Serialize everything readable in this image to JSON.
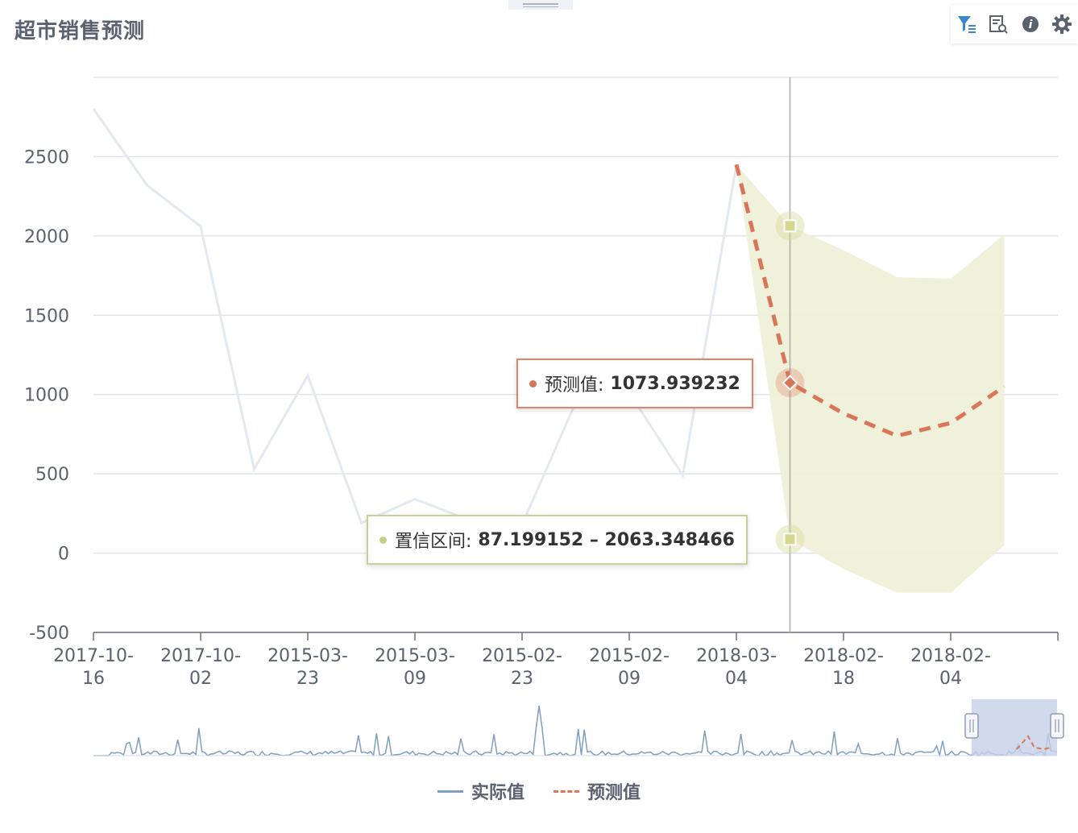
{
  "title": "超市销售预测",
  "toolbox": [
    {
      "name": "filter-icon",
      "color": "#3a87d0"
    },
    {
      "name": "data-view-icon",
      "color": "#5a6270"
    },
    {
      "name": "info-icon",
      "color": "#5a6270"
    },
    {
      "name": "settings-icon",
      "color": "#5a6270"
    }
  ],
  "colors": {
    "actual": "#7e9fbf",
    "forecast": "#d9765a",
    "band": "#eef0d6",
    "band_marker": "#d6dc9e"
  },
  "legend": [
    {
      "label": "实际值",
      "style": "solid"
    },
    {
      "label": "预测值",
      "style": "dashed"
    }
  ],
  "tooltips": {
    "forecast": {
      "label": "预测值:",
      "value": "1073.939232"
    },
    "interval": {
      "label": "置信区间:",
      "value": "87.199152 – 2063.348466"
    }
  },
  "chart_data": {
    "type": "line",
    "title": "超市销售预测",
    "ylim": [
      -500,
      3000
    ],
    "yticks": [
      -500,
      0,
      500,
      1000,
      1500,
      2000,
      2500
    ],
    "x_range": [
      0,
      9
    ],
    "xticks": [
      {
        "x": 0,
        "line1": "2017-10-",
        "line2": "16"
      },
      {
        "x": 1,
        "line1": "2017-10-",
        "line2": "02"
      },
      {
        "x": 2,
        "line1": "2015-03-",
        "line2": "23"
      },
      {
        "x": 3,
        "line1": "2015-03-",
        "line2": "09"
      },
      {
        "x": 4,
        "line1": "2015-02-",
        "line2": "23"
      },
      {
        "x": 5,
        "line1": "2015-02-",
        "line2": "09"
      },
      {
        "x": 6,
        "line1": "2018-03-",
        "line2": "04"
      },
      {
        "x": 7,
        "line1": "2018-02-",
        "line2": "18"
      },
      {
        "x": 8,
        "line1": "2018-02-",
        "line2": "04"
      }
    ],
    "grid": true,
    "legend_position": "bottom-center",
    "series": [
      {
        "name": "实际值",
        "points": [
          [
            0,
            2800
          ],
          [
            0.5,
            2320
          ],
          [
            1,
            2060
          ],
          [
            1.5,
            530
          ],
          [
            2,
            1120
          ],
          [
            2.5,
            190
          ],
          [
            3,
            340
          ],
          [
            3.5,
            210
          ],
          [
            4,
            180
          ],
          [
            4.5,
            950
          ],
          [
            5,
            1010
          ],
          [
            5.5,
            490
          ],
          [
            6,
            2450
          ]
        ]
      },
      {
        "name": "预测值",
        "points": [
          [
            6,
            2450
          ],
          [
            6.5,
            1073.939232
          ],
          [
            7,
            880
          ],
          [
            7.5,
            740
          ],
          [
            8,
            820
          ],
          [
            8.5,
            1050
          ]
        ],
        "interval": [
          [
            6,
            2450,
            2450
          ],
          [
            6.5,
            87.199152,
            2063.348466
          ],
          [
            7,
            -100,
            1910
          ],
          [
            7.5,
            -250,
            1740
          ],
          [
            8,
            -250,
            1730
          ],
          [
            8.5,
            50,
            2010
          ]
        ]
      }
    ],
    "highlight_x": 6.5
  },
  "overview": {
    "window": [
      0.96,
      1.0
    ]
  }
}
